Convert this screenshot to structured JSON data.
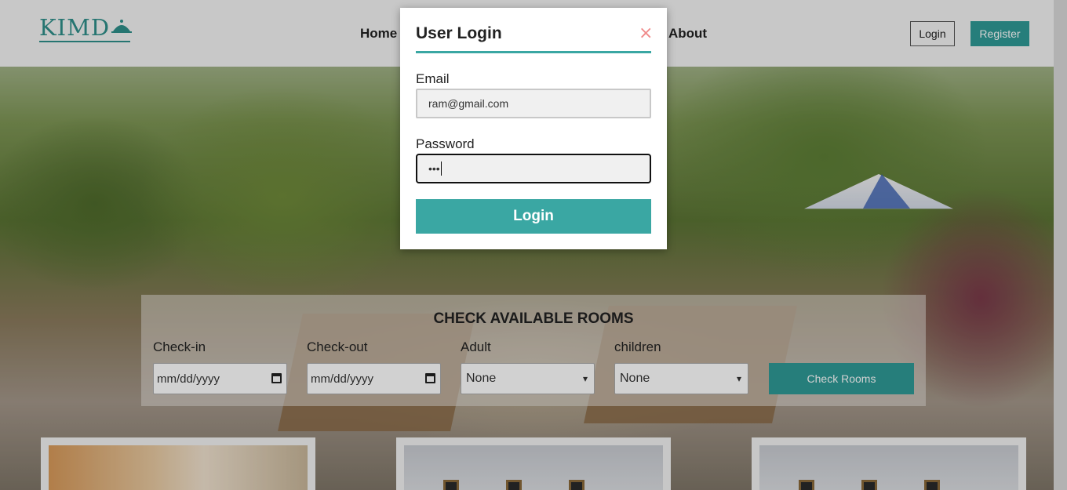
{
  "header": {
    "logo_text": "KIMD",
    "nav": {
      "home": "Home",
      "about": "About"
    },
    "login_label": "Login",
    "register_label": "Register"
  },
  "availability": {
    "title": "CHECK AVAILABLE ROOMS",
    "checkin_label": "Check-in",
    "checkin_value": "mm/dd/yyyy",
    "checkout_label": "Check-out",
    "checkout_value": "mm/dd/yyyy",
    "adult_label": "Adult",
    "adult_value": "None",
    "children_label": "children",
    "children_value": "None",
    "check_button": "Check Rooms"
  },
  "modal": {
    "title": "User Login",
    "close_symbol": "×",
    "email_label": "Email",
    "email_value": "ram@gmail.com",
    "password_label": "Password",
    "password_value": "•••",
    "login_button": "Login"
  },
  "colors": {
    "accent": "#3aa7a3",
    "close": "#f08a8a"
  }
}
